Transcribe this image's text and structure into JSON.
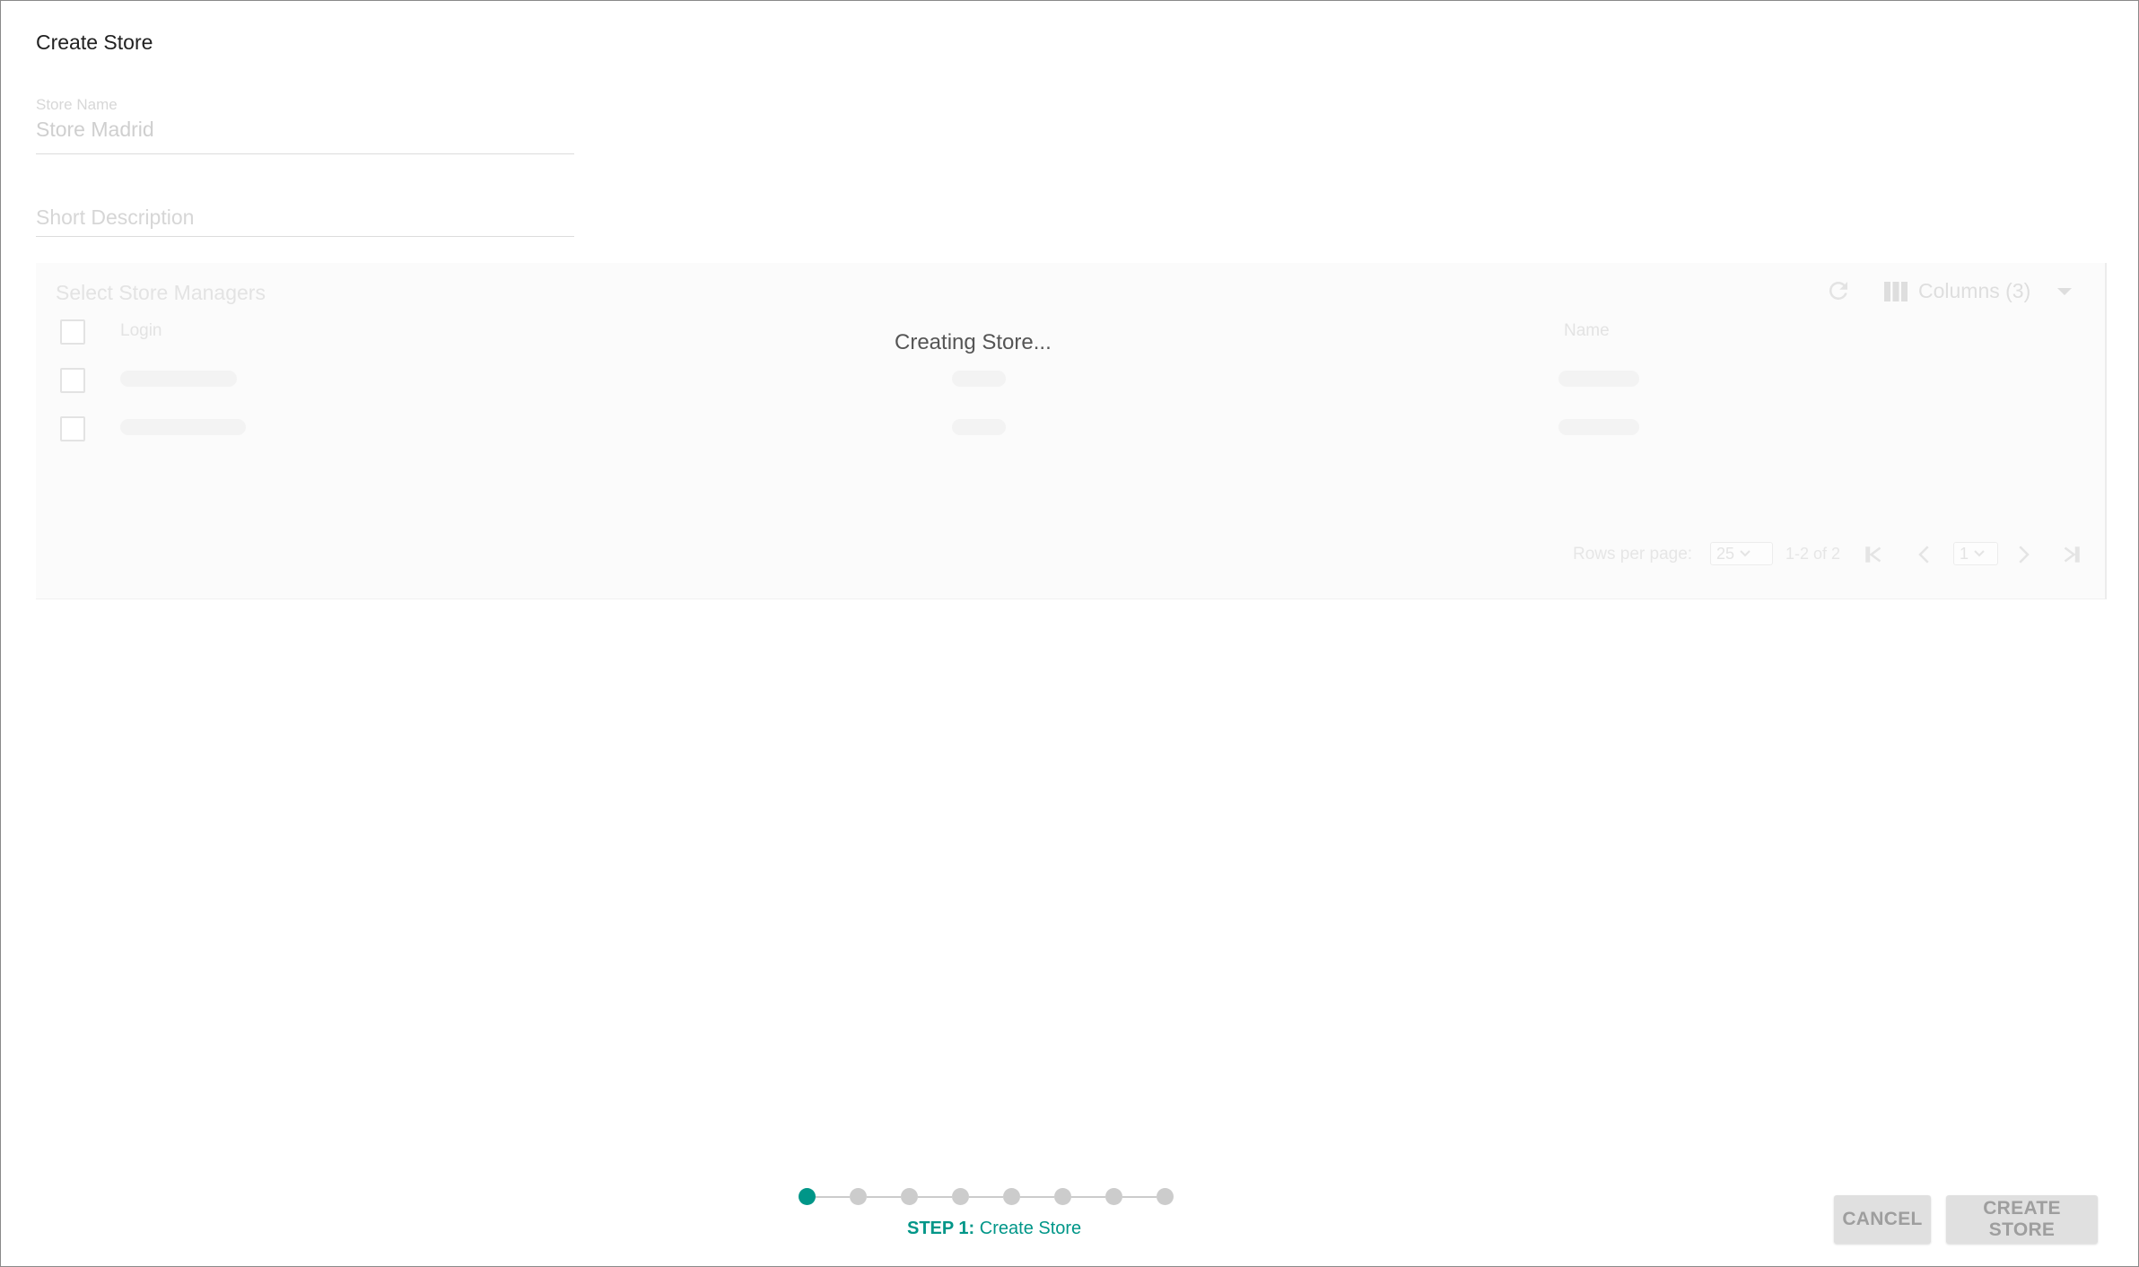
{
  "dialog": {
    "title": "Create Store"
  },
  "form": {
    "store_name_label": "Store Name",
    "store_name_value": "Store Madrid",
    "short_description_placeholder": "Short Description"
  },
  "managers": {
    "title": "Select Store Managers",
    "columns_label": "Columns (3)",
    "headers": {
      "login": "Login",
      "name": "Name"
    },
    "rows_count": 2
  },
  "pager": {
    "rows_per_page_label": "Rows per page:",
    "rows_per_page_value": "25",
    "range": "1-2 of 2",
    "page_value": "1"
  },
  "loading_text": "Creating Store...",
  "stepper": {
    "total_steps": 8,
    "active_step": 1,
    "step_prefix": "STEP 1:",
    "step_name": "Create Store"
  },
  "buttons": {
    "cancel": "CANCEL",
    "create": "CREATE STORE"
  },
  "colors": {
    "accent": "#009688",
    "inactive_dot": "#cccccc",
    "button_bg": "#e0e0e0",
    "button_text": "#9e9e9e"
  },
  "icons": [
    "refresh-icon",
    "columns-icon",
    "chevron-down-icon",
    "first-page-icon",
    "prev-page-icon",
    "next-page-icon",
    "last-page-icon"
  ]
}
